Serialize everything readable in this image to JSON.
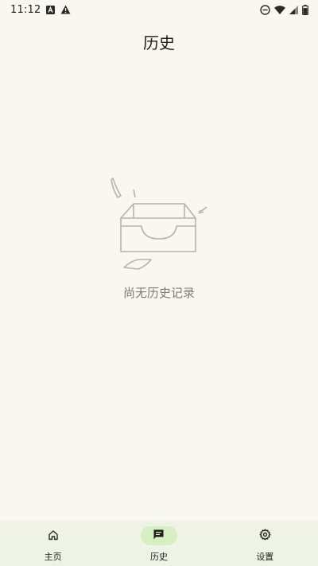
{
  "status_bar": {
    "time": "11:12",
    "left_icons": [
      "a-box-icon",
      "warning-icon"
    ],
    "right_icons": [
      "dnd-icon",
      "wifi-icon",
      "signal-icon",
      "battery-icon"
    ]
  },
  "header": {
    "title": "历史"
  },
  "empty_state": {
    "icon": "empty-tray-icon",
    "message": "尚无历史记录"
  },
  "bottom_nav": {
    "items": [
      {
        "label": "主页",
        "icon": "home-icon",
        "active": false
      },
      {
        "label": "历史",
        "icon": "history-icon",
        "active": true
      },
      {
        "label": "设置",
        "icon": "settings-icon",
        "active": false
      }
    ]
  },
  "colors": {
    "background": "#f8f8f1",
    "nav_background": "#eef3e6",
    "nav_active_pill": "#d6f0c4",
    "empty_text": "#7c7c78"
  }
}
